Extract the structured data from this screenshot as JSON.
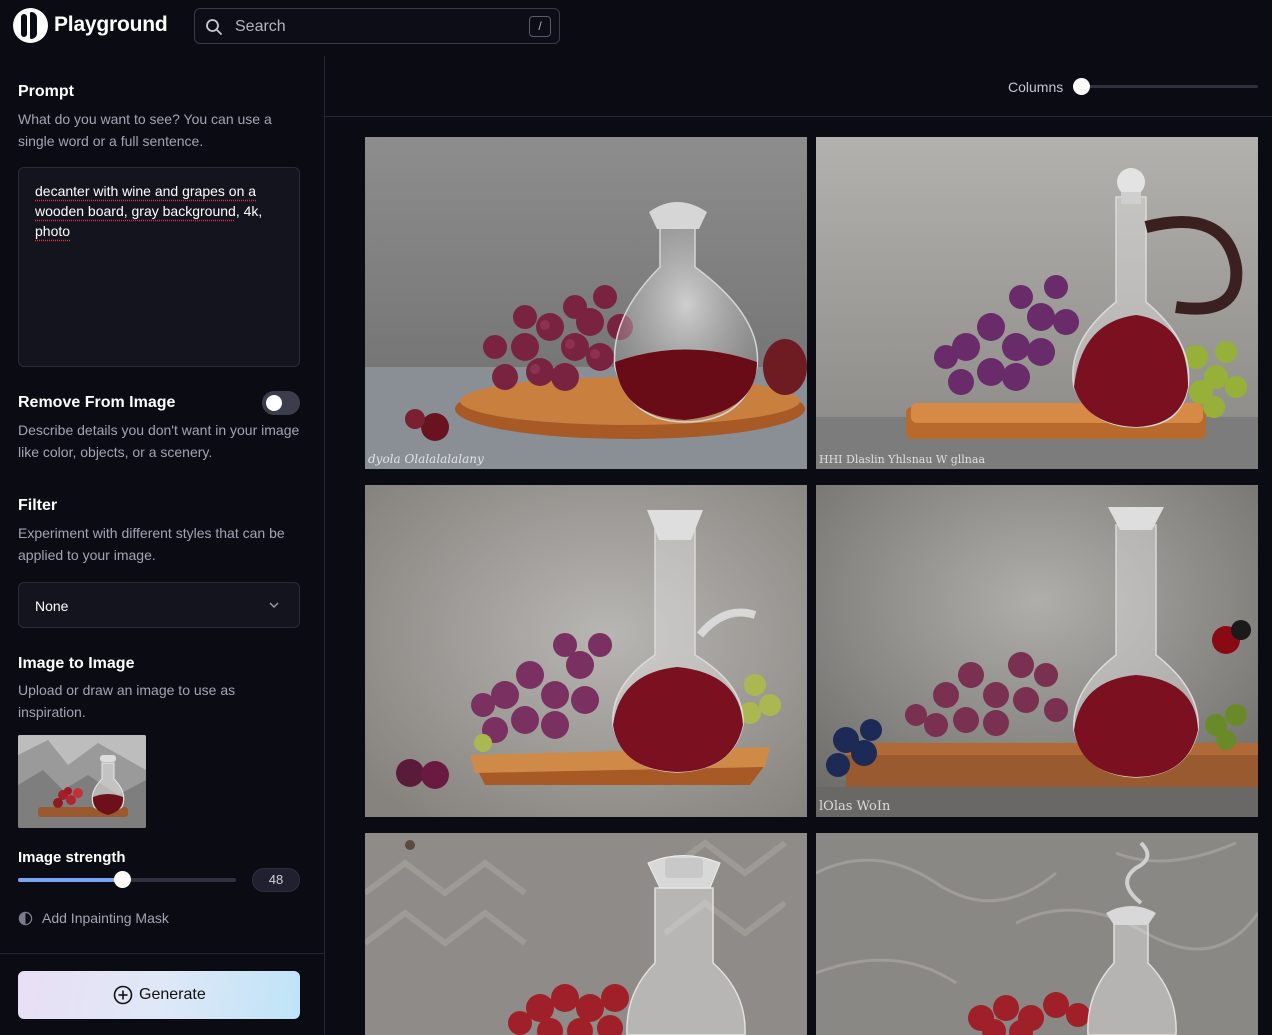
{
  "app": {
    "name": "Playground"
  },
  "search": {
    "placeholder": "Search",
    "shortcut": "/"
  },
  "prompt": {
    "title": "Prompt",
    "description": "What do you want to see? You can use a single word or a full sentence.",
    "value_parts": [
      "decanter with wine and grapes on a wooden board, gray background",
      ", 4k, ",
      "photo"
    ]
  },
  "remove_from_image": {
    "title": "Remove From Image",
    "description": "Describe details you don't want in your image like color, objects, or a scenery.",
    "enabled": false
  },
  "filter": {
    "title": "Filter",
    "description": "Experiment with different styles that can be applied to your image.",
    "selected": "None"
  },
  "image_to_image": {
    "title": "Image to Image",
    "description": "Upload or draw an image to use as inspiration.",
    "strength_label": "Image strength",
    "strength_value": "48",
    "inpaint_label": "Add Inpainting Mask"
  },
  "generate": {
    "label": "Generate"
  },
  "gallery": {
    "columns_label": "Columns",
    "columns_level": 0,
    "watermarks": [
      "dyola Olalalalalany",
      "HHI Dlaslin Yhlsnau W gllnaa",
      "",
      "lOlas WoIn"
    ]
  },
  "colors": {
    "background": "#0b0b14",
    "accent": "#7ea4f6",
    "wine": "#6e0f1c",
    "grape": "#7a2a4d"
  }
}
